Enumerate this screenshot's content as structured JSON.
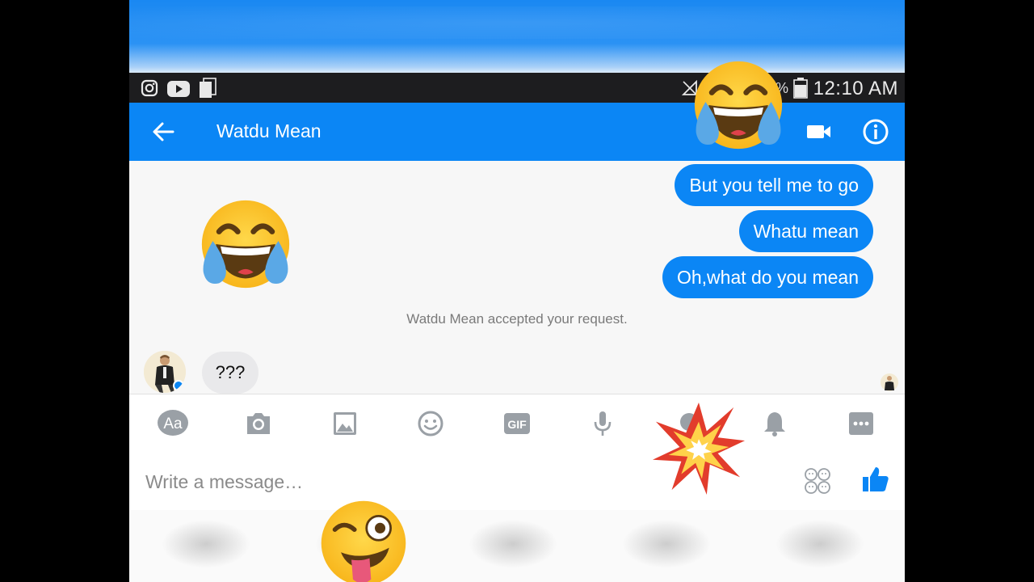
{
  "status": {
    "time": "12:10 AM",
    "battery_text": "%",
    "left_icons": [
      "instagram-icon",
      "youtube-icon",
      "recent-apps-icon"
    ],
    "right_icons": [
      "no-signal-icon",
      "battery-icon"
    ]
  },
  "header": {
    "title": "Watdu Mean",
    "icons": [
      "back-arrow-icon",
      "video-call-icon",
      "info-icon"
    ]
  },
  "messages": {
    "outgoing": [
      "But you tell me to go",
      "Whatu mean",
      "Oh,what do you mean"
    ],
    "system": "Watdu Mean accepted your request.",
    "incoming": [
      "???"
    ]
  },
  "toolbar": {
    "text_mode_label": "Aa",
    "gif_label": "GIF",
    "icons": [
      "text-mode-icon",
      "camera-icon",
      "gallery-icon",
      "emoji-icon",
      "gif-icon",
      "microphone-icon",
      "location-icon",
      "bell-icon",
      "more-icon"
    ]
  },
  "composer": {
    "placeholder": "Write a message…",
    "icons": [
      "stickers-icon",
      "like-thumb-icon"
    ]
  },
  "overlays": [
    "tears-of-joy-emoji",
    "tears-of-joy-emoji",
    "collision-emoji",
    "winking-tongue-emoji"
  ],
  "colors": {
    "accent": "#0b86f5",
    "status_bar": "#1d1d1f",
    "bubble_out": "#0b86f5",
    "bubble_in": "#e9e9eb"
  }
}
